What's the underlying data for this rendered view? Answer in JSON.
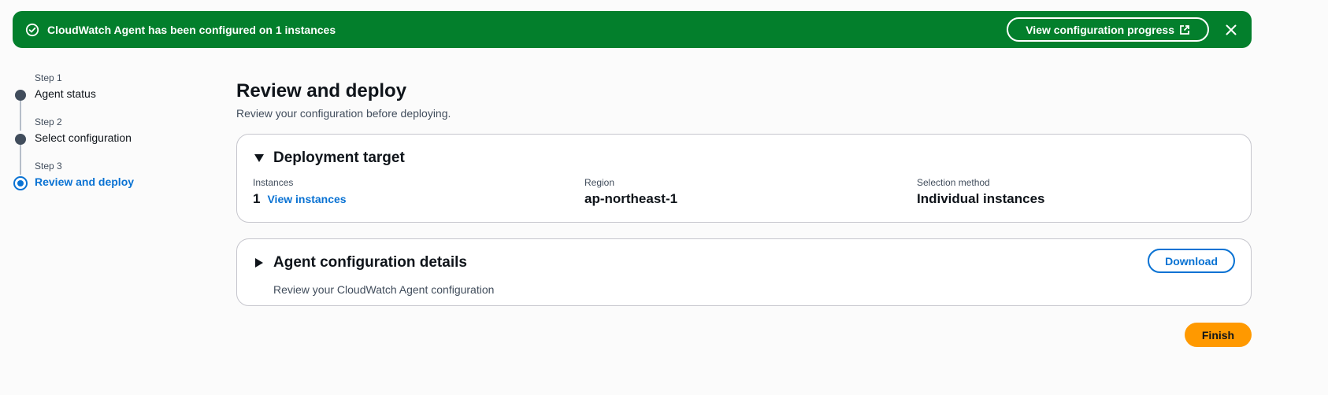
{
  "flash": {
    "message": "CloudWatch Agent has been configured on 1 instances",
    "action_label": "View configuration progress",
    "status_icon": "success-circle-icon",
    "close_icon": "close-icon",
    "color": "#037f2c"
  },
  "steps": [
    {
      "number": "Step 1",
      "title": "Agent status",
      "state": "complete"
    },
    {
      "number": "Step 2",
      "title": "Select configuration",
      "state": "complete"
    },
    {
      "number": "Step 3",
      "title": "Review and deploy",
      "state": "active"
    }
  ],
  "main": {
    "title": "Review and deploy",
    "description": "Review your configuration before deploying."
  },
  "deployment_target": {
    "title": "Deployment target",
    "instances_label": "Instances",
    "instances_value": "1",
    "instances_link": "View instances",
    "region_label": "Region",
    "region_value": "ap-northeast-1",
    "selection_label": "Selection method",
    "selection_value": "Individual instances"
  },
  "agent_config": {
    "title": "Agent configuration details",
    "description": "Review your CloudWatch Agent configuration",
    "download_label": "Download"
  },
  "finish_label": "Finish",
  "colors": {
    "accent": "#0972d3",
    "primary_button": "#ff9900"
  }
}
